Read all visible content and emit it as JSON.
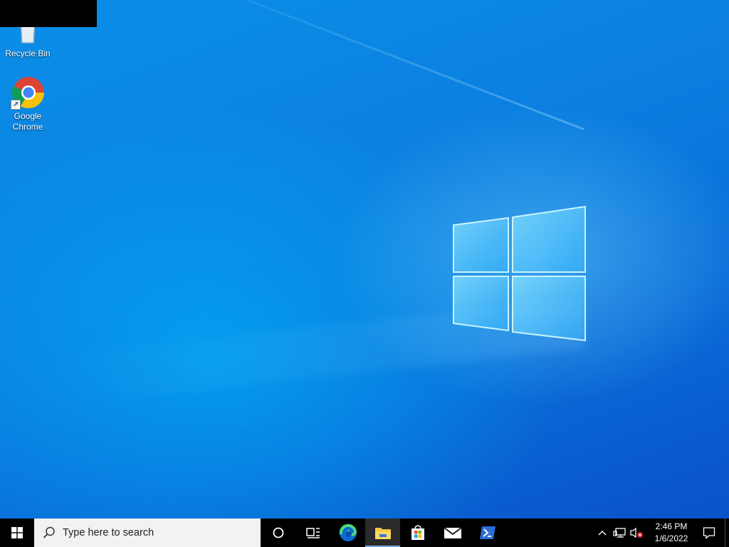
{
  "desktop": {
    "icons": [
      {
        "label": "Recycle Bin"
      },
      {
        "label_line1": "Google",
        "label_line2": "Chrome"
      }
    ]
  },
  "taskbar": {
    "search": {
      "placeholder": "Type here to search"
    },
    "apps": [
      {
        "name": "cortana-icon"
      },
      {
        "name": "task-view-icon"
      },
      {
        "name": "edge-icon"
      },
      {
        "name": "file-explorer-icon",
        "active": true
      },
      {
        "name": "microsoft-store-icon"
      },
      {
        "name": "mail-icon"
      },
      {
        "name": "powershell-icon"
      }
    ],
    "tray": {
      "time": "2:46 PM",
      "date": "1/6/2022"
    }
  },
  "colors": {
    "desktop_blue": "#0a7fe0",
    "taskbar": "#000000",
    "search_bg": "#f2f2f2"
  }
}
